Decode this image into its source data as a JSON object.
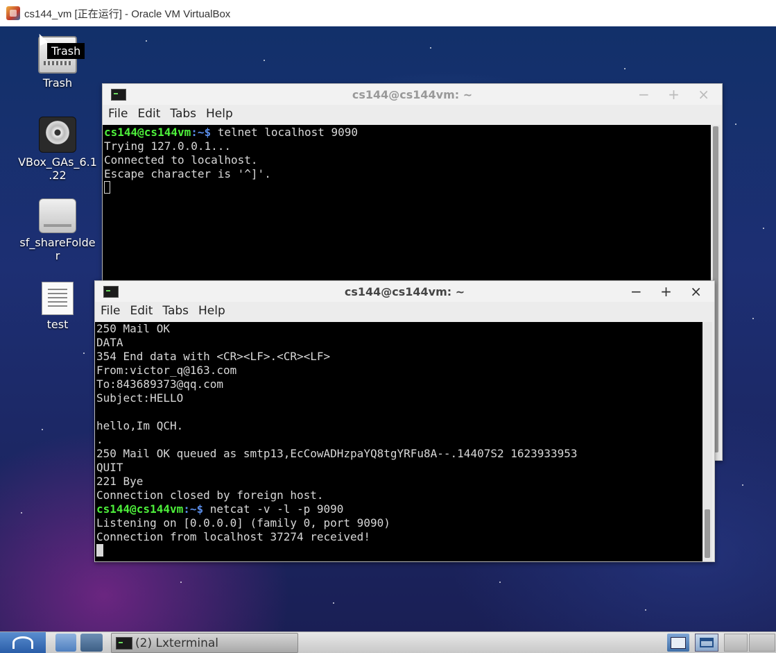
{
  "host_window": {
    "title": "cs144_vm [正在运行] - Oracle VM VirtualBox"
  },
  "desktop": {
    "tooltip": "Trash",
    "icons": [
      {
        "label": "Trash",
        "icon": "trash-icon"
      },
      {
        "label": "VBox_GAs_6.1\n.22",
        "icon": "cd-icon"
      },
      {
        "label": "sf_shareFolde\nr",
        "icon": "drive-icon"
      },
      {
        "label": "test",
        "icon": "text-file-icon"
      }
    ]
  },
  "terminal_back": {
    "title": "cs144@cs144vm: ~",
    "menu": [
      "File",
      "Edit",
      "Tabs",
      "Help"
    ],
    "prompt_user": "cs144@cs144vm",
    "prompt_sep": ":~$",
    "command": " telnet localhost 9090",
    "lines": [
      "Trying 127.0.0.1...",
      "Connected to localhost.",
      "Escape character is '^]'."
    ]
  },
  "terminal_front": {
    "title": "cs144@cs144vm: ~",
    "menu": [
      "File",
      "Edit",
      "Tabs",
      "Help"
    ],
    "lines_before": [
      "250 Mail OK",
      "DATA",
      "354 End data with <CR><LF>.<CR><LF>",
      "From:victor_q@163.com",
      "To:843689373@qq.com",
      "Subject:HELLO",
      "",
      "hello,Im QCH.",
      ".",
      "250 Mail OK queued as smtp13,EcCowADHzpaYQ8tgYRFu8A--.14407S2 1623933953",
      "QUIT",
      "221 Bye",
      "Connection closed by foreign host."
    ],
    "prompt_user": "cs144@cs144vm",
    "prompt_sep": ":~$",
    "command": " netcat -v -l -p 9090",
    "lines_after": [
      "Listening on [0.0.0.0] (family 0, port 9090)",
      "Connection from localhost 37274 received!"
    ]
  },
  "window_buttons": "− + ×",
  "taskbar": {
    "task_label": "(2) Lxterminal"
  }
}
